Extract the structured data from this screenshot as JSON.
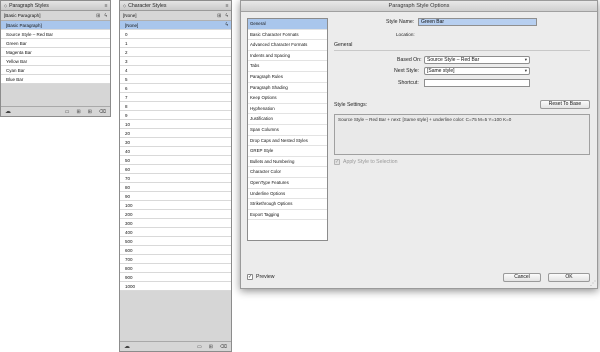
{
  "paragraph_styles": {
    "title": "Paragraph Styles",
    "current": "[Basic Paragraph]",
    "items": [
      "[Basic Paragraph]",
      "Source Style – Red Bar",
      "Green Bar",
      "Magenta Bar",
      "Yellow Bar",
      "Cyan Bar",
      "Blue Bar"
    ]
  },
  "character_styles": {
    "title": "Character Styles",
    "current": "[None]",
    "items": [
      "[None]",
      "0",
      "1",
      "2",
      "3",
      "4",
      "5",
      "6",
      "7",
      "8",
      "9",
      "10",
      "20",
      "30",
      "40",
      "50",
      "60",
      "70",
      "80",
      "90",
      "100",
      "200",
      "300",
      "400",
      "500",
      "600",
      "700",
      "800",
      "900",
      "1000"
    ]
  },
  "dialog": {
    "title": "Paragraph Style Options",
    "categories": [
      "General",
      "Basic Character Formats",
      "Advanced Character Formats",
      "Indents and Spacing",
      "Tabs",
      "Paragraph Rules",
      "Paragraph Shading",
      "Keep Options",
      "Hyphenation",
      "Justification",
      "Span Columns",
      "Drop Caps and Nested Styles",
      "GREP Style",
      "Bullets and Numbering",
      "Character Color",
      "OpenType Features",
      "Underline Options",
      "Strikethrough Options",
      "Export Tagging"
    ],
    "style_name_label": "Style Name:",
    "style_name_value": "Green Bar",
    "location_label": "Location:",
    "section_title": "General",
    "based_on_label": "Based On:",
    "based_on_value": "Source Style – Red Bar",
    "next_style_label": "Next Style:",
    "next_style_value": "[Same style]",
    "shortcut_label": "Shortcut:",
    "shortcut_value": "",
    "style_settings_label": "Style Settings:",
    "reset_button": "Reset To Base",
    "style_settings_text": "Source Style – Red Bar + next: [Same style] + underline color: C=75 M=5 Y=100 K=0",
    "apply_label": "Apply Style to Selection",
    "preview_label": "Preview",
    "cancel_label": "Cancel",
    "ok_label": "OK"
  },
  "icons": {
    "collapse": "◇",
    "menu": "≡",
    "close": "✕",
    "lightning": "ϟ",
    "cloud": "☁",
    "folder": "▭",
    "new_style": "⊞",
    "trash": "⌫",
    "check": "✓",
    "arrow": "▾"
  }
}
